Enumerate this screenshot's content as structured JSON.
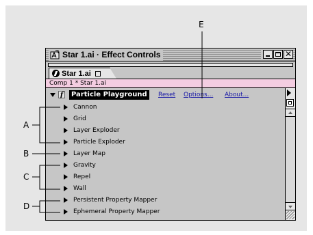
{
  "window": {
    "title": "Star 1.ai · Effect Controls",
    "tab_label": "Star 1.ai",
    "breadcrumb": "Comp 1 * Star 1.ai"
  },
  "effect": {
    "name": "Particle Playground",
    "fx_glyph": "f",
    "links": {
      "reset": "Reset",
      "options": "Options...",
      "about": "About..."
    }
  },
  "properties": [
    "Cannon",
    "Grid",
    "Layer Exploder",
    "Particle Exploder",
    "Layer Map",
    "Gravity",
    "Repel",
    "Wall",
    "Persistent Property Mapper",
    "Ephemeral Property Mapper"
  ],
  "callouts": {
    "a": "A",
    "b": "B",
    "c": "C",
    "d": "D",
    "e": "E"
  },
  "icons": {
    "app": "after-effects-icon",
    "min": "minimize-icon",
    "max": "maximize-icon",
    "close": "close-icon"
  },
  "colors": {
    "breadcrumb_bg": "#f4cde1",
    "link": "#1a1aa6",
    "panel": "#c6c6c6"
  }
}
